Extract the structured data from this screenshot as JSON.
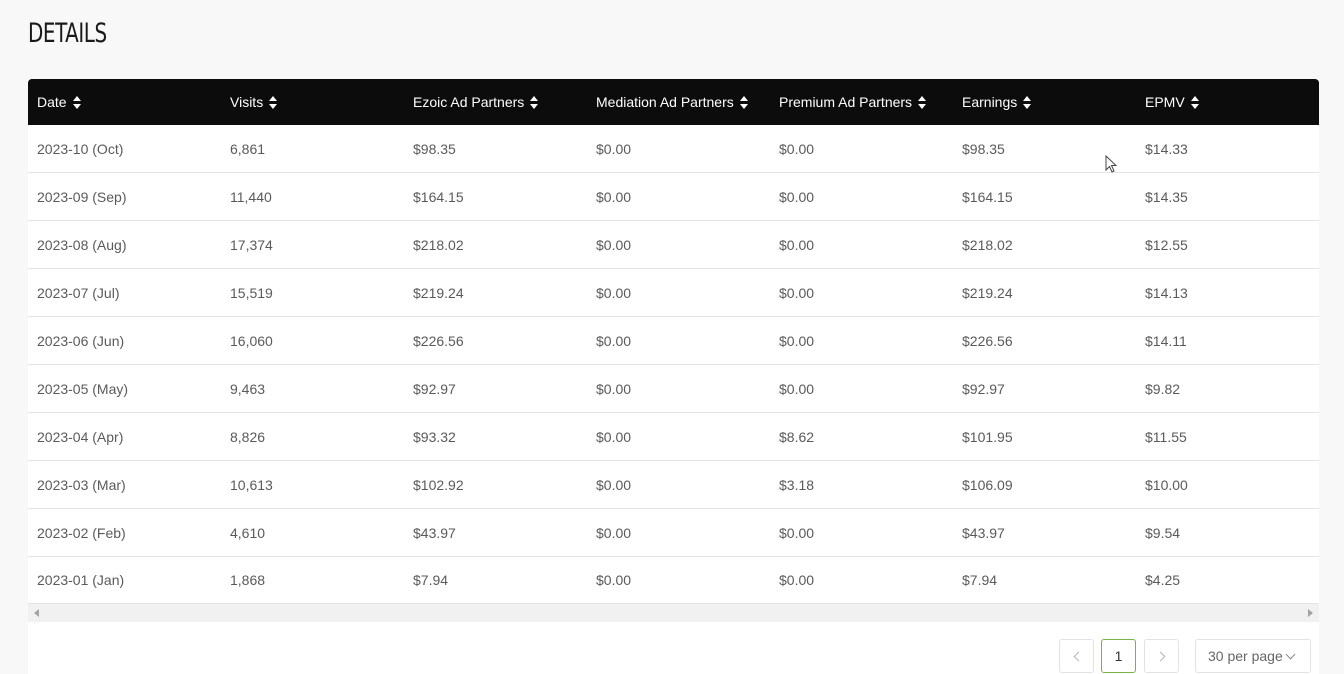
{
  "section_title": "DETAILS",
  "columns": [
    "Date",
    "Visits",
    "Ezoic Ad Partners",
    "Mediation Ad Partners",
    "Premium Ad Partners",
    "Earnings",
    "EPMV"
  ],
  "rows": [
    [
      "2023-10 (Oct)",
      "6,861",
      "$98.35",
      "$0.00",
      "$0.00",
      "$98.35",
      "$14.33"
    ],
    [
      "2023-09 (Sep)",
      "11,440",
      "$164.15",
      "$0.00",
      "$0.00",
      "$164.15",
      "$14.35"
    ],
    [
      "2023-08 (Aug)",
      "17,374",
      "$218.02",
      "$0.00",
      "$0.00",
      "$218.02",
      "$12.55"
    ],
    [
      "2023-07 (Jul)",
      "15,519",
      "$219.24",
      "$0.00",
      "$0.00",
      "$219.24",
      "$14.13"
    ],
    [
      "2023-06 (Jun)",
      "16,060",
      "$226.56",
      "$0.00",
      "$0.00",
      "$226.56",
      "$14.11"
    ],
    [
      "2023-05 (May)",
      "9,463",
      "$92.97",
      "$0.00",
      "$0.00",
      "$92.97",
      "$9.82"
    ],
    [
      "2023-04 (Apr)",
      "8,826",
      "$93.32",
      "$0.00",
      "$8.62",
      "$101.95",
      "$11.55"
    ],
    [
      "2023-03 (Mar)",
      "10,613",
      "$102.92",
      "$0.00",
      "$3.18",
      "$106.09",
      "$10.00"
    ],
    [
      "2023-02 (Feb)",
      "4,610",
      "$43.97",
      "$0.00",
      "$0.00",
      "$43.97",
      "$9.54"
    ],
    [
      "2023-01 (Jan)",
      "1,868",
      "$7.94",
      "$0.00",
      "$0.00",
      "$7.94",
      "$4.25"
    ]
  ],
  "pagination": {
    "current_page": "1",
    "per_page_label": "30 per page"
  },
  "icons": {
    "sort": "sort-icon",
    "prev": "chevron-left-icon",
    "next": "chevron-right-icon",
    "dropdown": "chevron-down-icon"
  },
  "colors": {
    "header_bg": "#0c0c0c",
    "active_page_border": "#7bb24a"
  }
}
